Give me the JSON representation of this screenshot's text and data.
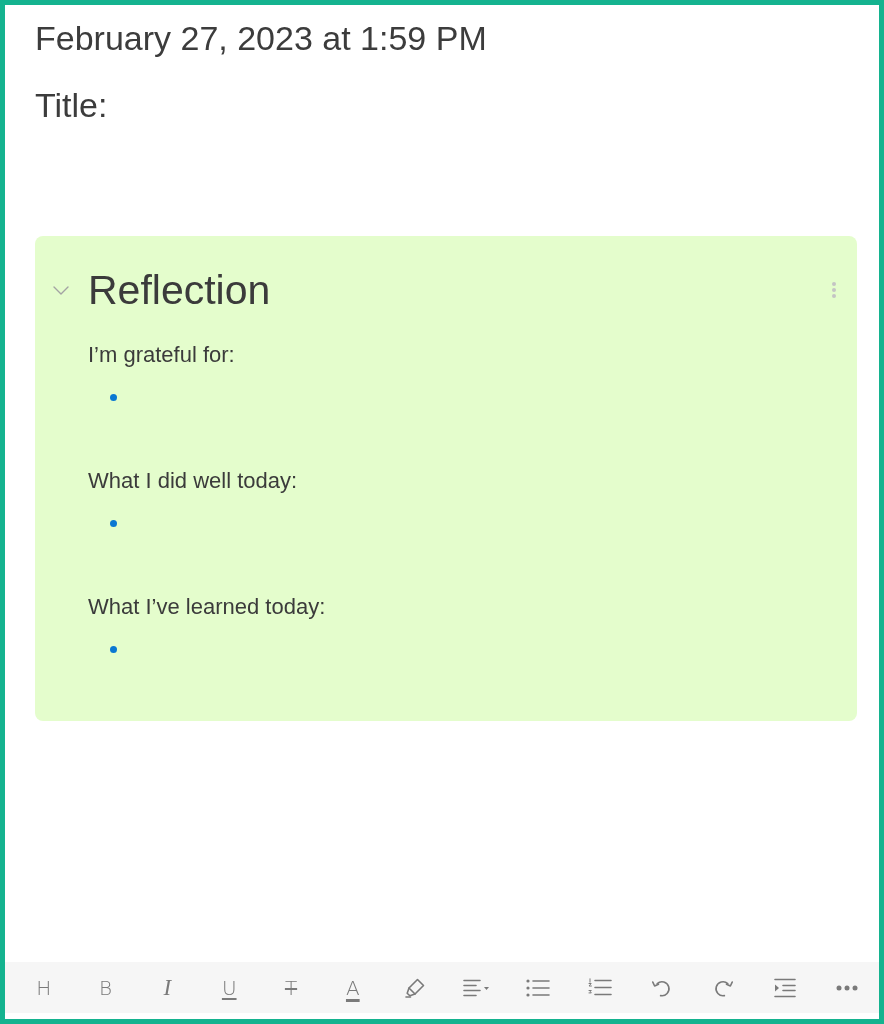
{
  "timestamp": "February 27, 2023 at 1:59 PM",
  "title_label": "Title:",
  "section": {
    "title": "Reflection",
    "expanded": true,
    "prompts": [
      {
        "text": "I’m grateful for:",
        "bullet": true
      },
      {
        "text": "What I did well today:",
        "bullet": true
      },
      {
        "text": "What I’ve learned today:",
        "bullet": true
      }
    ]
  },
  "toolbar": [
    {
      "kind": "heading",
      "label": "H"
    },
    {
      "kind": "bold",
      "label": "B"
    },
    {
      "kind": "italic",
      "label": "I"
    },
    {
      "kind": "underline",
      "label": "U"
    },
    {
      "kind": "strikethrough",
      "label": "T"
    },
    {
      "kind": "text-color",
      "label": "A"
    },
    {
      "kind": "highlight"
    },
    {
      "kind": "align"
    },
    {
      "kind": "bullet-list"
    },
    {
      "kind": "numbered-list"
    },
    {
      "kind": "undo"
    },
    {
      "kind": "redo"
    },
    {
      "kind": "indent"
    },
    {
      "kind": "more"
    }
  ]
}
